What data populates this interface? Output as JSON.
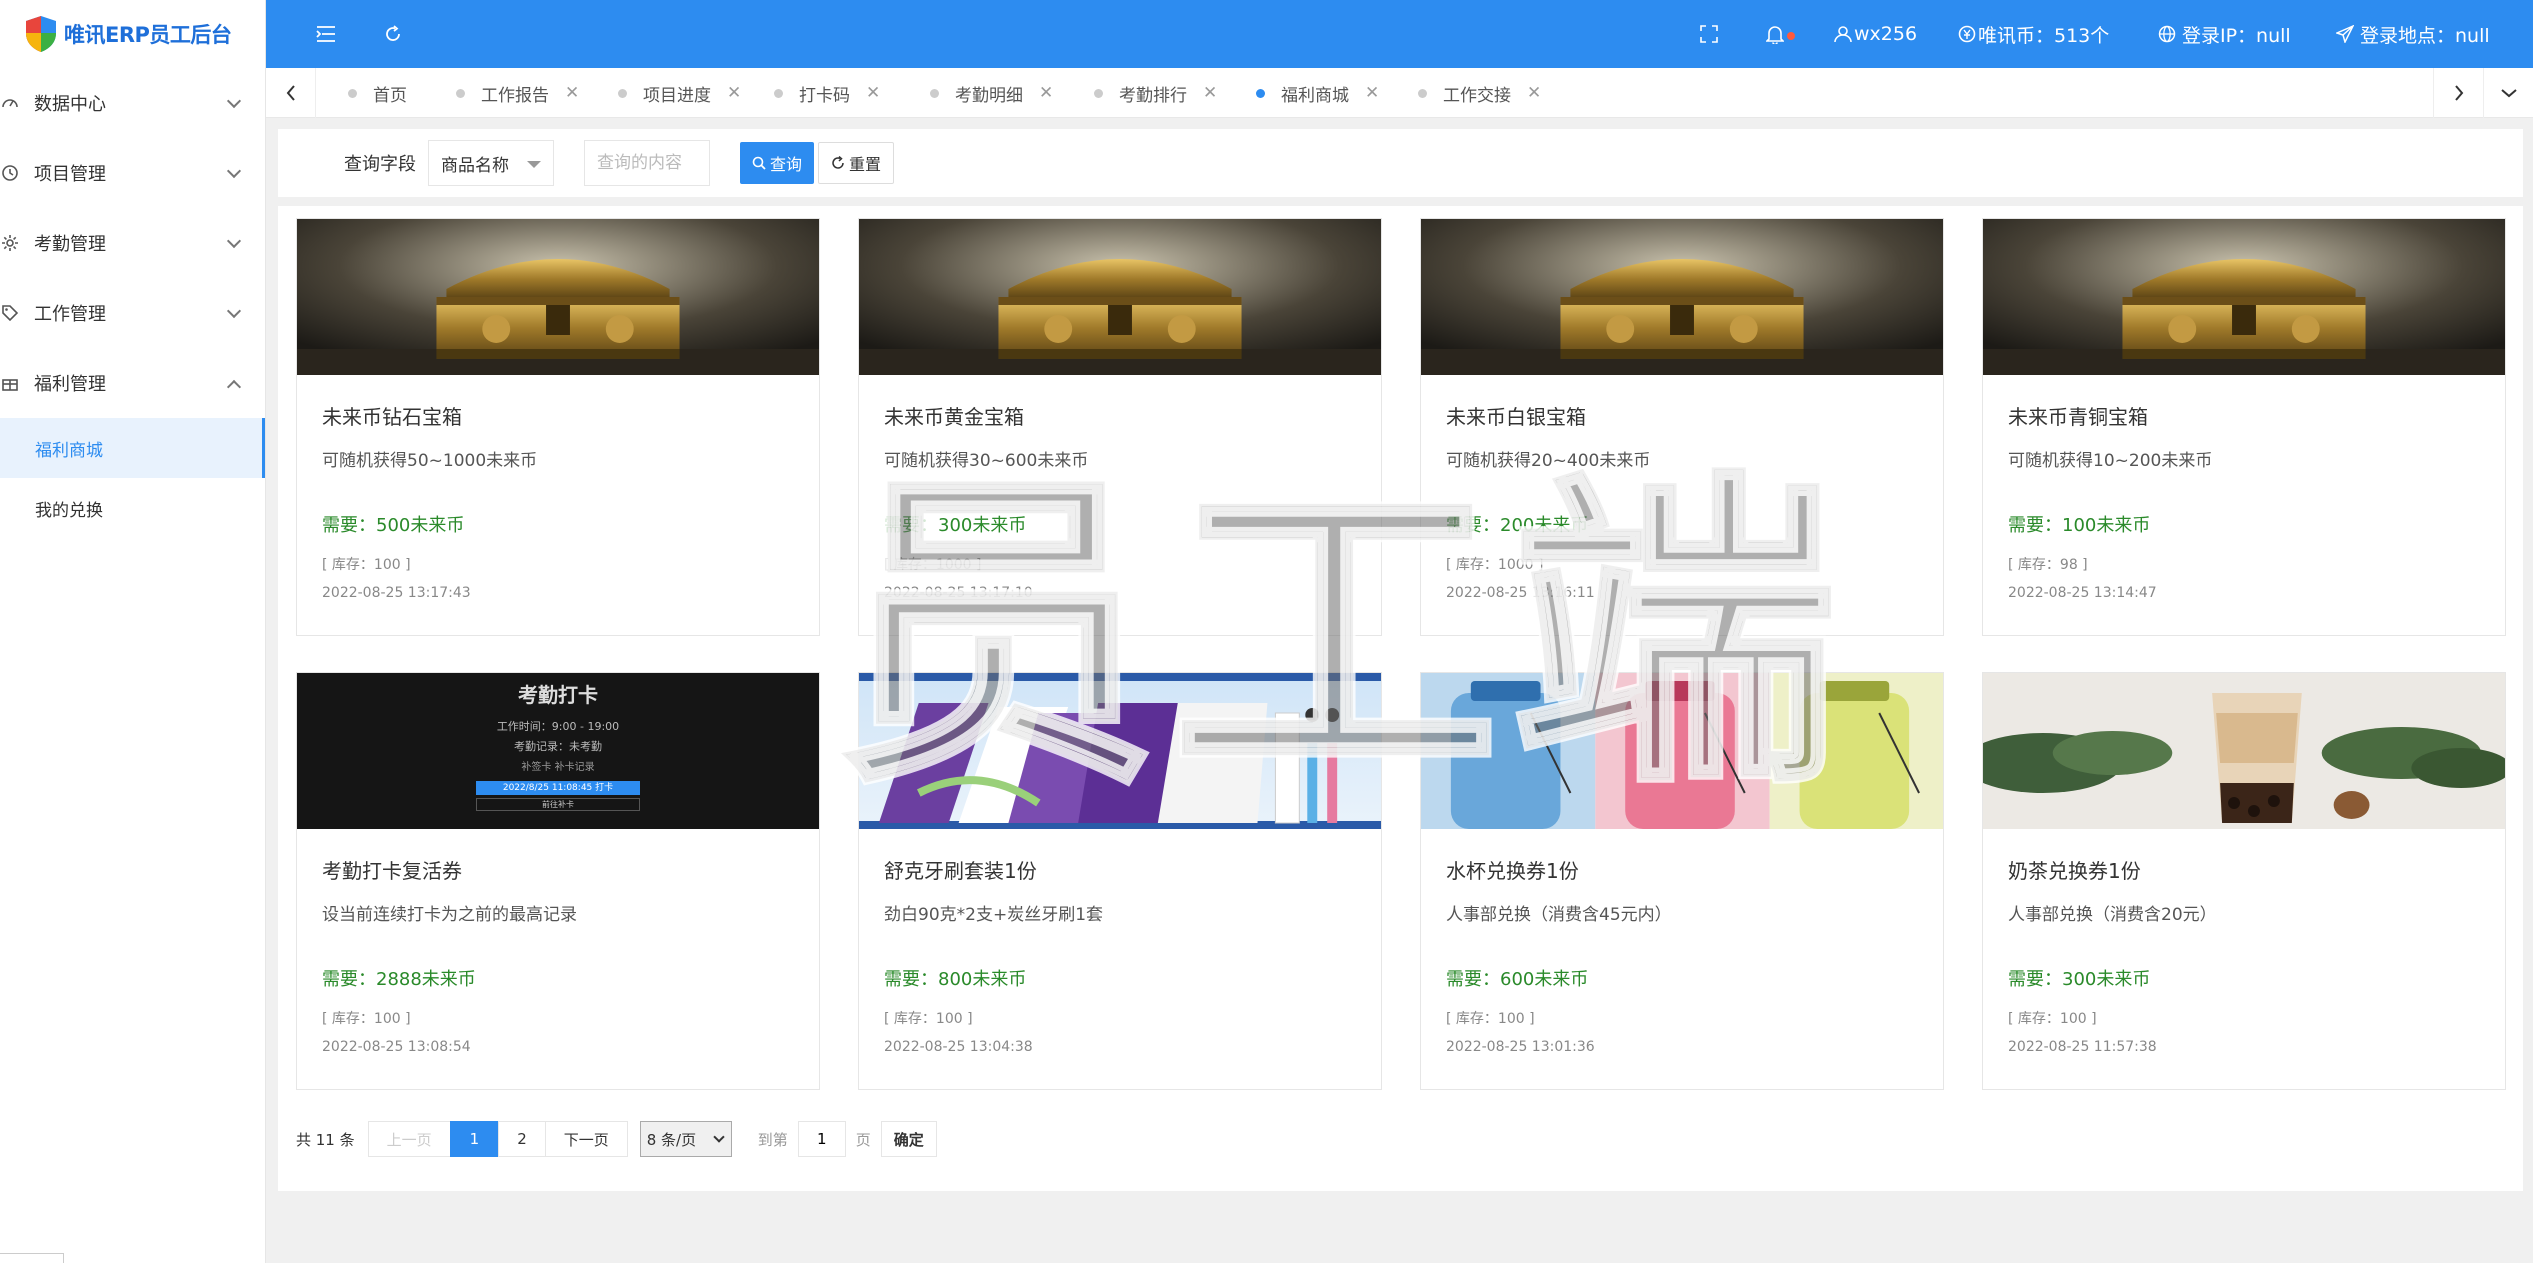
{
  "app": {
    "title": "唯讯ERP员工后台"
  },
  "sidebar": {
    "groups": [
      {
        "label": "数据中心",
        "icon": "dashboard-icon",
        "expanded": false
      },
      {
        "label": "项目管理",
        "icon": "clock-icon",
        "expanded": false
      },
      {
        "label": "考勤管理",
        "icon": "gear-icon",
        "expanded": false
      },
      {
        "label": "工作管理",
        "icon": "tag-icon",
        "expanded": false
      },
      {
        "label": "福利管理",
        "icon": "gift-icon",
        "expanded": true
      }
    ],
    "sub_items": [
      {
        "label": "福利商城",
        "active": true
      },
      {
        "label": "我的兑换",
        "active": false
      }
    ]
  },
  "header": {
    "user": "wx256",
    "coins": "唯讯币：513个",
    "login_ip": "登录IP：null",
    "login_location": "登录地点：null"
  },
  "tabs": [
    {
      "label": "首页",
      "closable": false,
      "active": false
    },
    {
      "label": "工作报告",
      "closable": true,
      "active": false
    },
    {
      "label": "项目进度",
      "closable": true,
      "active": false
    },
    {
      "label": "打卡码",
      "closable": true,
      "active": false
    },
    {
      "label": "考勤明细",
      "closable": true,
      "active": false
    },
    {
      "label": "考勤排行",
      "closable": true,
      "active": false
    },
    {
      "label": "福利商城",
      "closable": true,
      "active": true
    },
    {
      "label": "工作交接",
      "closable": true,
      "active": false
    }
  ],
  "search": {
    "field_label": "查询字段",
    "field_value": "商品名称",
    "placeholder": "查询的内容",
    "query_label": "查询",
    "reset_label": "重置"
  },
  "products": [
    {
      "name": "未来币钻石宝箱",
      "desc": "可随机获得50~1000未来币",
      "price": "需要：500未来币",
      "stock": "[ 库存：100 ]",
      "time": "2022-08-25 13:17:43",
      "image": "chest"
    },
    {
      "name": "未来币黄金宝箱",
      "desc": "可随机获得30~600未来币",
      "price": "需要：300未来币",
      "stock": "[ 库存：1000 ]",
      "time": "2022-08-25 13:17:10",
      "image": "chest"
    },
    {
      "name": "未来币白银宝箱",
      "desc": "可随机获得20~400未来币",
      "price": "需要：200未来币",
      "stock": "[ 库存：1000 ]",
      "time": "2022-08-25 13:16:11",
      "image": "chest"
    },
    {
      "name": "未来币青铜宝箱",
      "desc": "可随机获得10~200未来币",
      "price": "需要：100未来币",
      "stock": "[ 库存：98 ]",
      "time": "2022-08-25 13:14:47",
      "image": "chest"
    },
    {
      "name": "考勤打卡复活券",
      "desc": "设当前连续打卡为之前的最高记录",
      "price": "需要：2888未来币",
      "stock": "[ 库存：100 ]",
      "time": "2022-08-25 13:08:54",
      "image": "checkin"
    },
    {
      "name": "舒克牙刷套装1份",
      "desc": "劲白90克*2支+炭丝牙刷1套",
      "price": "需要：800未来币",
      "stock": "[ 库存：100 ]",
      "time": "2022-08-25 13:04:38",
      "image": "toothpaste"
    },
    {
      "name": "水杯兑换券1份",
      "desc": "人事部兑换（消费含45元内）",
      "price": "需要：600未来币",
      "stock": "[ 库存：100 ]",
      "time": "2022-08-25 13:01:36",
      "image": "bottles"
    },
    {
      "name": "奶茶兑换券1份",
      "desc": "人事部兑换（消费含20元）",
      "price": "需要：300未来币",
      "stock": "[ 库存：100 ]",
      "time": "2022-08-25 11:57:38",
      "image": "milktea"
    }
  ],
  "checkin_image": {
    "title": "考勤打卡",
    "lines": [
      "工作时间：9:00 - 19:00",
      "考勤记录：未考勤",
      "补签卡   补卡记录"
    ],
    "button": "2022/8/25 11:08:45 打卡",
    "button2": "前往补卡"
  },
  "pagination": {
    "total": "共 11 条",
    "prev": "上一页",
    "pages": [
      "1",
      "2"
    ],
    "current": "1",
    "next": "下一页",
    "size": "8 条/页",
    "goto": "到第",
    "goto_value": "1",
    "unit": "页",
    "confirm": "确定"
  },
  "watermark": "员工端",
  "colors": {
    "primary": "#2d8cf0",
    "price": "#2a8a2a"
  }
}
